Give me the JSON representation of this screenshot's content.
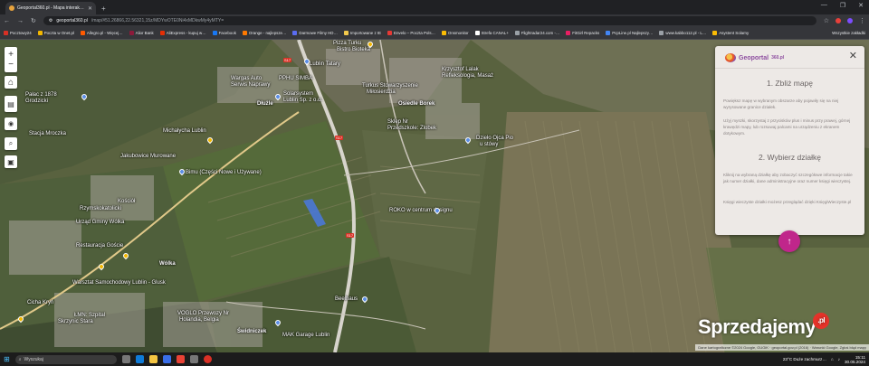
{
  "browser": {
    "tab_title": "Geoportal360.pl - Mapa interak…",
    "url_domain": "geoportal360.pl",
    "url_path": "/map/#51.26866,22.56321,15z/MDYwOTE0Ni4xMDkwMy4yMTY="
  },
  "bookmarks": [
    {
      "label": "Pocztowy24",
      "color": "#d93025"
    },
    {
      "label": "Poczta w Onet.pl",
      "color": "#f2b600"
    },
    {
      "label": "Allegro.pl - Więcej…",
      "color": "#ff5a00"
    },
    {
      "label": "Alior Bank",
      "color": "#8b1a3a"
    },
    {
      "label": "AliExpress - kupuj w…",
      "color": "#e62e04"
    },
    {
      "label": "Facebook",
      "color": "#1877f2"
    },
    {
      "label": "Orange - najlepsze…",
      "color": "#ff7900"
    },
    {
      "label": "Darmowe Filmy HD…",
      "color": "#5a6cf0"
    },
    {
      "label": "Importowane z IE",
      "color": "#f2c94c"
    },
    {
      "label": "Envelo – Poczta Pols…",
      "color": "#e53935"
    },
    {
      "label": "Onsmonitor",
      "color": "#fbbc04"
    },
    {
      "label": "Strefa CANAL+",
      "color": "#ffffff"
    },
    {
      "label": "Flightradar24.com -…",
      "color": "#9aa0a6"
    },
    {
      "label": "FitGirl Repacks",
      "color": "#e91e63"
    },
    {
      "label": "PcpLine.pl Najlepszy…",
      "color": "#4285f4"
    },
    {
      "label": "www.kabbo112.pl - L…",
      "color": "#9aa0a6"
    },
    {
      "label": "Asystent Solarny",
      "color": "#fbbc04"
    }
  ],
  "bookmarks_other": "Wszystkie zakładki",
  "map": {
    "controls": {
      "zoom_in": "+",
      "zoom_out": "−"
    },
    "labels": [
      "Pizza Turku",
      "Bistro Bioteka",
      "Lublin Tatary",
      "Krzysztof Lalak",
      "Refleksologia, Masaż",
      "Pałac z 1878",
      "Wiejski",
      "Grodzicki",
      "Wargas Auto",
      "Serwis Naprawy",
      "PPHU SIMBA",
      "Kolor",
      "Solarsystem",
      "Lublin Sp. z o.o.",
      "Dłużle",
      "Turkus Stowarzyszenie",
      "Miłosierdzia",
      "Osiedle Borek",
      "Sklep Nr",
      "Przedszkole: Zlobek",
      "Stacja Mroczka",
      "Michałycha Lublin",
      "Dzieło Ojca Pio",
      "u stówy",
      "Jakubowice Murowane",
      "Bimu (Części Nowe i Używane)",
      "Rzymskokatolicki",
      "Kościół",
      "Urząd Gminy Wólka",
      "Restauracja Goście",
      "ROKO w centrum designu",
      "Gości",
      "Wólka",
      "Warsztat Samochodowy Lublin - Glusk",
      "Cicha Kryń",
      "ŁMN: Szpital",
      "Skrzynic Stara",
      "VOGLO Przewozy Nr",
      "Holandia, Belgia",
      "Świdniczek",
      "MAK Garage Lublin",
      "Beelhaus",
      "Kolumbia"
    ]
  },
  "panel": {
    "logo_text": "Geoportal",
    "logo_suffix": "360.pl",
    "section1_title": "1. Zbliż mapę",
    "section1_p1": "Powiększ mapę w wybranym obszarze aby pojawiły się na niej wyrysowane granice działek.",
    "section1_p2": "Użyj myszki, skorzystaj z przycisków plus i minus przy prawej, górnej krawędzi mapy, lub rozsuwaj palcami na urządzeniu z ekranem dotykowym.",
    "section2_title": "2. Wybierz działkę",
    "section2_p1": "Kliknij na wybraną działkę aby zobaczyć szczegółowe informacje takie jak numer działki, dane administracyjne oraz numer księgi wieczystej.",
    "section2_p2": "Księgi wieczyste działki możesz przeglądać dzięki KsięgiWieczyste.pl",
    "fab_icon": "↑"
  },
  "watermark": {
    "text": "Sprzedajemy",
    "suffix": ".pl"
  },
  "attribution": "Dane kartograficzne ©2024 Google, GUGiK · geoportal.gov.pl (2016) · Warunki Google, Zgłoś błąd mapy",
  "taskbar": {
    "search_placeholder": "Wyszukaj",
    "weather": "23°C Duże zachmurz…",
    "time": "15:11",
    "date": "30.05.2024"
  }
}
